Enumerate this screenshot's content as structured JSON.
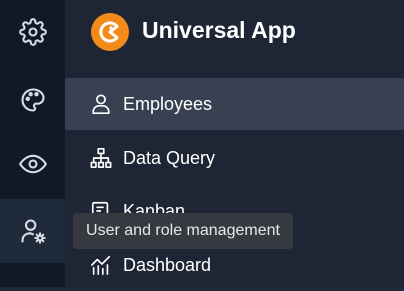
{
  "app": {
    "title": "Universal App"
  },
  "rail": {
    "items": [
      {
        "icon": "gear-icon",
        "active": false
      },
      {
        "icon": "palette-icon",
        "active": false
      },
      {
        "icon": "eye-icon",
        "active": false
      },
      {
        "icon": "user-gear-icon",
        "active": true
      }
    ]
  },
  "menu": {
    "items": [
      {
        "label": "Employees",
        "icon": "user-icon",
        "selected": true
      },
      {
        "label": "Data Query",
        "icon": "hierarchy-icon",
        "selected": false
      },
      {
        "label": "Kanban",
        "icon": "kanban-icon",
        "selected": false
      },
      {
        "label": "Dashboard",
        "icon": "chart-icon",
        "selected": false
      }
    ]
  },
  "tooltip": {
    "text": "User and role management"
  },
  "colors": {
    "accent": "#f38b1b",
    "rail_bg": "#101927",
    "main_bg": "#1e2635",
    "selected_bg": "#374151",
    "tooltip_bg": "#363a40"
  }
}
